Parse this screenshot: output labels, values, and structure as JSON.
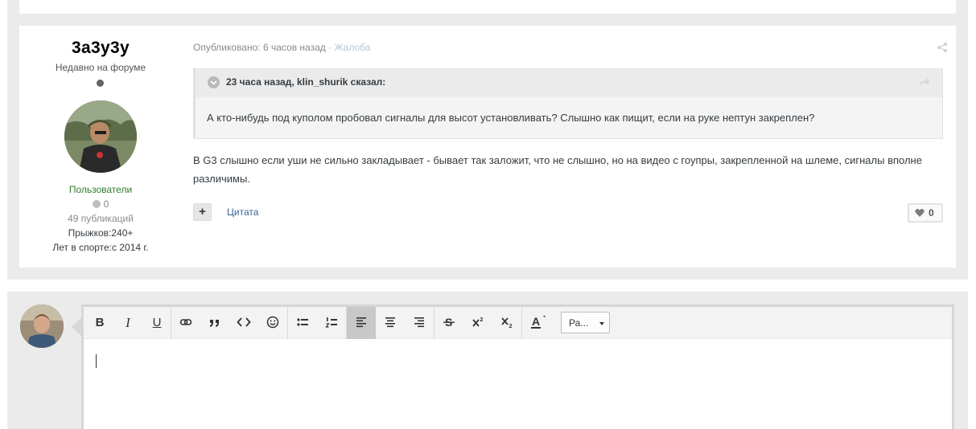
{
  "post": {
    "author": {
      "name": "3а3у3у",
      "status": "Недавно на форуме",
      "group": "Пользователи",
      "reputation": "0",
      "posts_count": "49 публикаций",
      "jumps": "Прыжков:240+",
      "years": "Лет в спорте:с 2014 г."
    },
    "meta": {
      "published": "Опубликовано: 6 часов назад",
      "separator": "·",
      "report": "Жалоба"
    },
    "quote": {
      "cite": "23 часа назад, klin_shurik сказал:",
      "text": "А кто-нибудь под куполом пробовал сигналы для высот установливать? Слышно как пищит, если на руке нептун закреплен?"
    },
    "body": "В G3 слышно если уши не сильно закладывает - бывает так заложит, что не слышно, но на видео с гоупры, закрепленной на шлеме, сигналы вполне различимы.",
    "actions": {
      "plus": "+",
      "quote_label": "Цитата",
      "likes": "0"
    }
  },
  "editor": {
    "toolbar": {
      "bold": "B",
      "italic": "I",
      "underline": "U",
      "format_select": "Ра..."
    }
  },
  "colors": {
    "accent_link": "#3d6594",
    "group_green": "#2f7d2f",
    "active_tool": "#c8c8c8"
  }
}
